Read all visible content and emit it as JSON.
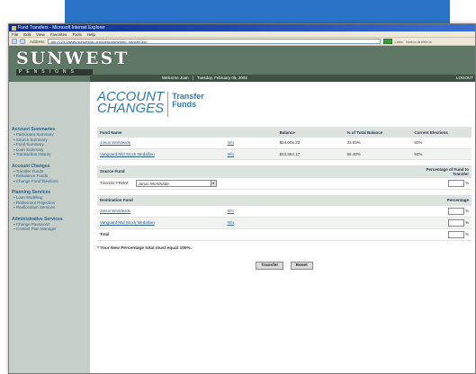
{
  "window": {
    "title": "Fund Transfers - Microsoft Internet Explorer",
    "menu": [
      "File",
      "Edit",
      "View",
      "Favorites",
      "Tools",
      "Help"
    ],
    "address_label": "Address",
    "address": "http://123.0/www.sunwestdc.org/participant/fund_transfer.asp",
    "links_label": "Links",
    "norton_label": "Norton AntiVirus"
  },
  "header": {
    "logo": "SUNWEST",
    "logo_sub": "PENSIONS",
    "welcome": "Welcome Joan",
    "date": "Tuesday, February 05, 2002",
    "logout": "LOGOUT"
  },
  "sidebar": {
    "groups": [
      {
        "title": "Account Summaries",
        "items": [
          "Participant Summary",
          "Source Summary",
          "Fund Summary",
          "Loan Summary",
          "Transaction History"
        ]
      },
      {
        "title": "Account Changes",
        "items": [
          "Transfer Funds",
          "Rebalance Funds",
          "Change Fund Elections"
        ]
      },
      {
        "title": "Planning Services",
        "items": [
          "Loan Modeling",
          "Retirement Projection",
          "Reallocation Services"
        ]
      },
      {
        "title": "Administrative Services",
        "items": [
          "Change Password",
          "Contact Plan Manager"
        ]
      }
    ]
  },
  "content": {
    "heading_main_1": "ACCOUNT",
    "heading_main_2": "CHANGES",
    "heading_sub_1": "Transfer",
    "heading_sub_2": "Funds",
    "funds_table": {
      "headers": [
        "Fund Name",
        "",
        "Balance",
        "% of Total Balance",
        "Current Elections"
      ],
      "rows": [
        {
          "name": "Janus Worldwide",
          "info": "Info",
          "balance": "$24,005.23",
          "pct": "33.59%",
          "election": "50%"
        },
        {
          "name": "Vanguard Mid Stock Medallion",
          "info": "Info",
          "balance": "$43,864.17",
          "pct": "66.40%",
          "election": "50%"
        }
      ]
    },
    "source_table": {
      "header": "Source Fund",
      "header_right": "Percentage of Fund to Transfer",
      "from_label": "Transfer FROM:",
      "selected_fund": "Janus Worldwide",
      "pct_symbol": "%"
    },
    "destination_table": {
      "header": "Destination Fund",
      "header_right": "Percentage",
      "rows": [
        {
          "name": "Janus Worldwide",
          "info": "Info",
          "pct_symbol": "%"
        },
        {
          "name": "Vanguard Mid Stock Medallion",
          "info": "Info",
          "pct_symbol": "%"
        }
      ],
      "total_label": "Total",
      "total_pct_symbol": "%"
    },
    "note": "* Your New Percentage total must equal 100%.",
    "transfer_button": "Transfer",
    "reset_button": "Reset"
  }
}
